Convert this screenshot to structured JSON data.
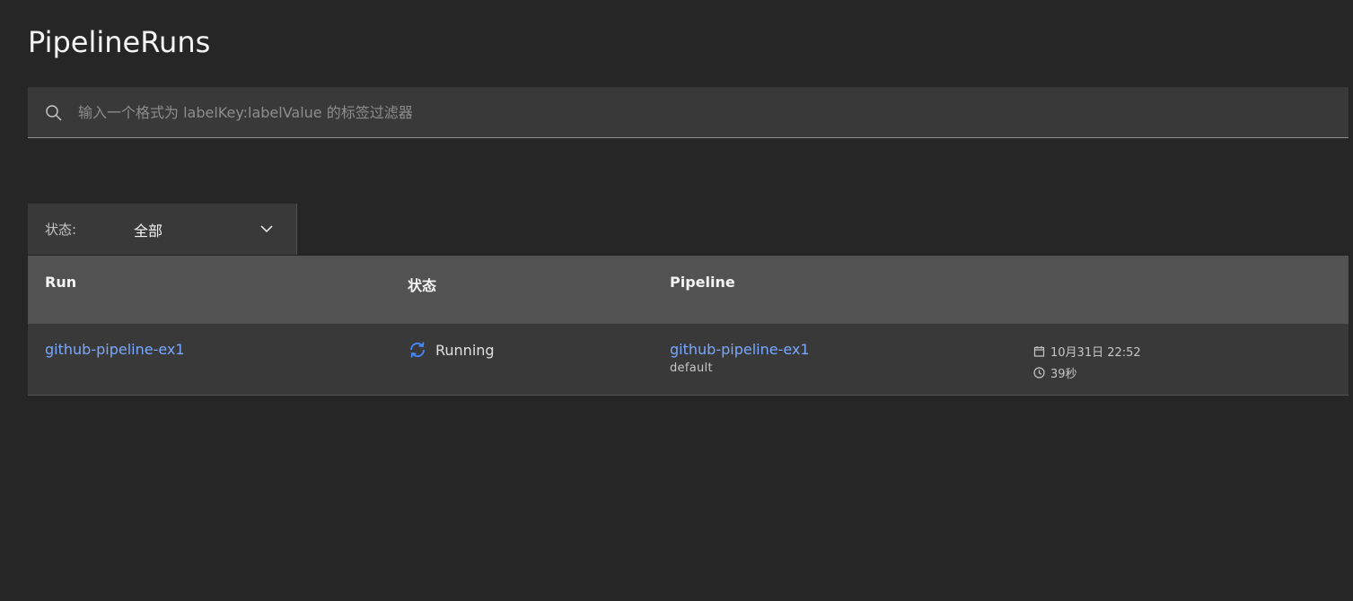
{
  "page": {
    "title": "PipelineRuns"
  },
  "search": {
    "placeholder": "输入一个格式为 labelKey:labelValue 的标签过滤器",
    "value": "",
    "icon": "search-icon"
  },
  "filter": {
    "label": "状态:",
    "selected": "全部",
    "icon": "chevron-down-icon"
  },
  "table": {
    "columns": [
      "Run",
      "状态",
      "Pipeline"
    ],
    "rows": [
      {
        "run": "github-pipeline-ex1",
        "status": "Running",
        "status_icon": "refresh-running-icon",
        "pipeline": "github-pipeline-ex1",
        "namespace": "default",
        "date": "10月31日 22:52",
        "duration": "39秒"
      }
    ]
  },
  "colors": {
    "background": "#262626",
    "surface": "#393939",
    "header": "#525252",
    "link": "#78a9ff",
    "running_icon": "#4589ff"
  }
}
